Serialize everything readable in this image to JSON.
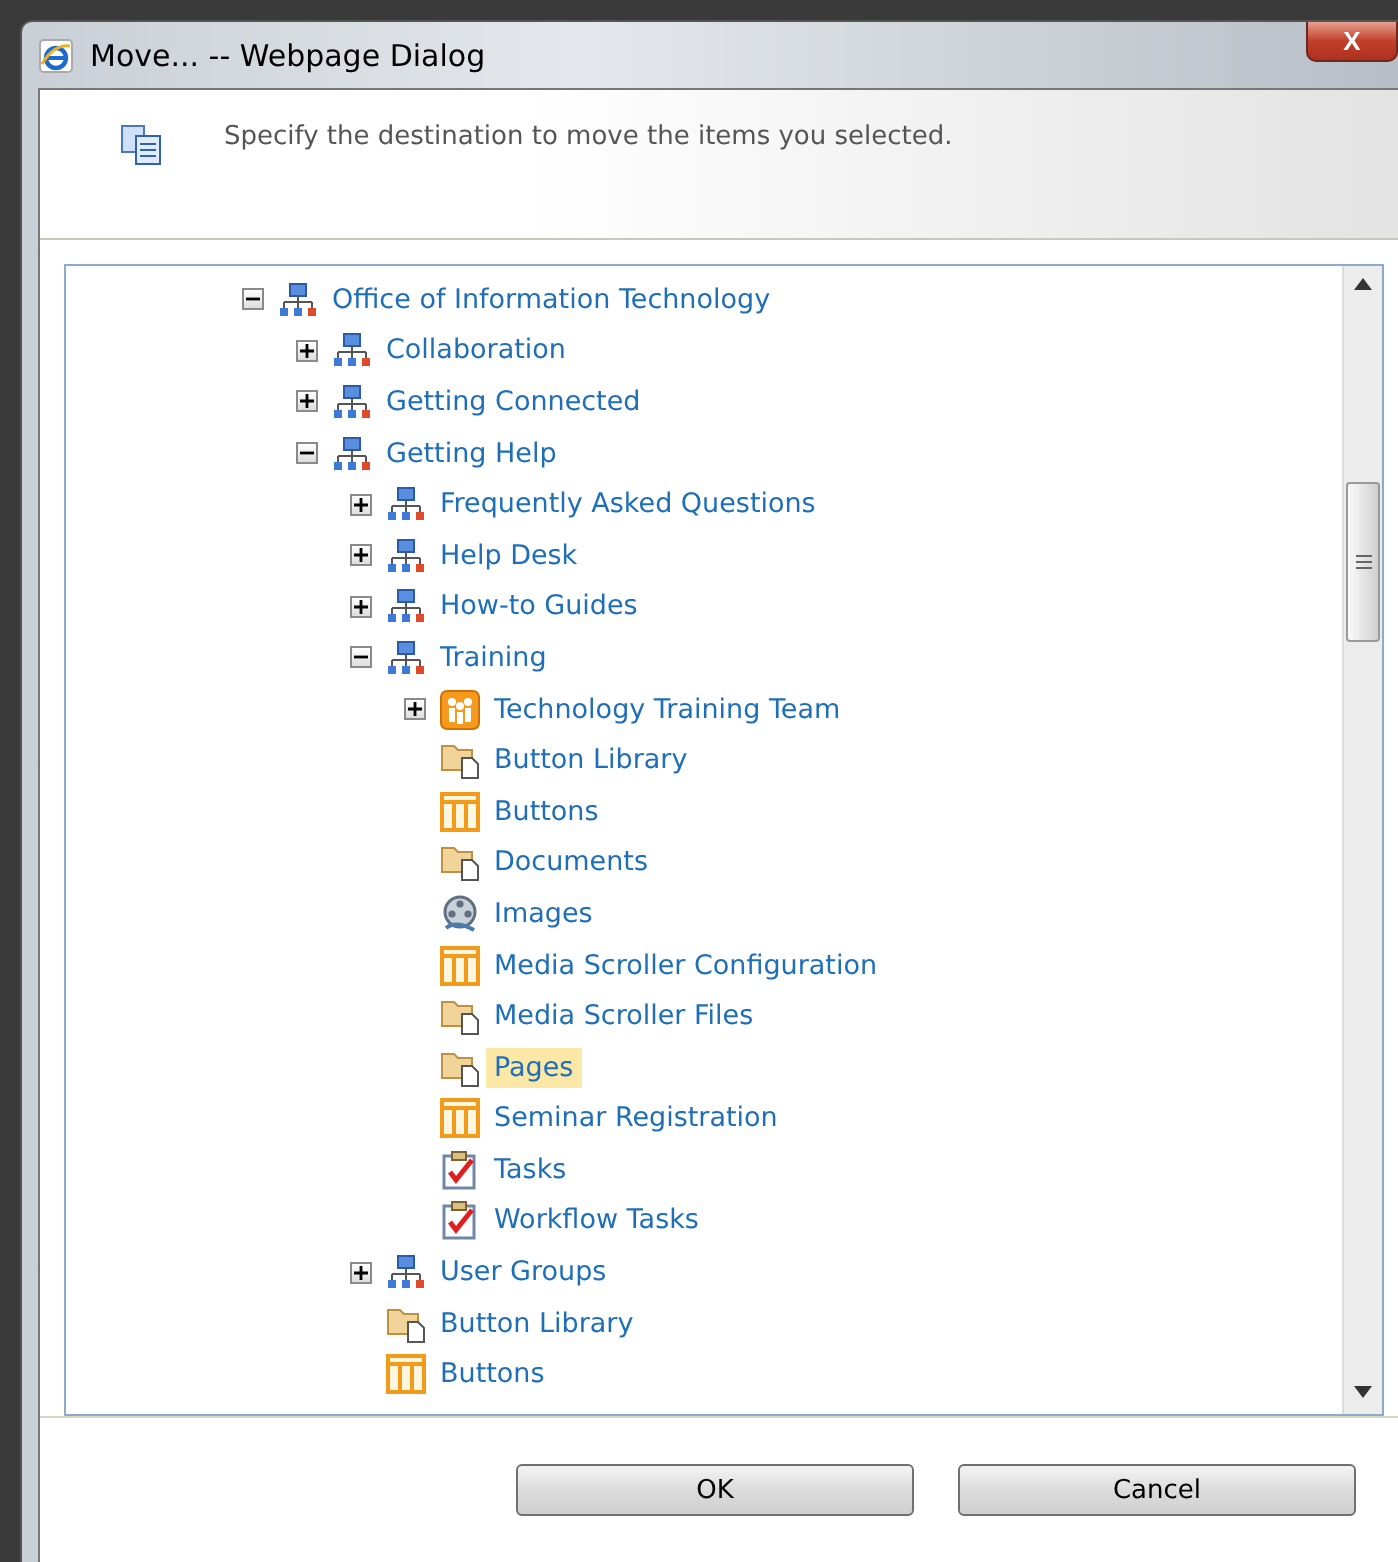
{
  "window": {
    "title": "Move... -- Webpage Dialog",
    "close": "X"
  },
  "instruction": "Specify the destination to move the items you selected.",
  "tree": [
    {
      "kind": "site",
      "label": "Office of Information Technology",
      "expanded": true,
      "selected": false,
      "children": [
        {
          "kind": "site",
          "label": "Collaboration",
          "expanded": false,
          "selected": false
        },
        {
          "kind": "site",
          "label": "Getting Connected",
          "expanded": false,
          "selected": false
        },
        {
          "kind": "site",
          "label": "Getting Help",
          "expanded": true,
          "selected": false,
          "children": [
            {
              "kind": "site",
              "label": "Frequently Asked Questions",
              "expanded": false,
              "selected": false
            },
            {
              "kind": "site",
              "label": "Help Desk",
              "expanded": false,
              "selected": false
            },
            {
              "kind": "site",
              "label": "How-to Guides",
              "expanded": false,
              "selected": false
            },
            {
              "kind": "site",
              "label": "Training",
              "expanded": true,
              "selected": false,
              "children": [
                {
                  "kind": "team",
                  "label": "Technology Training Team",
                  "expanded": false,
                  "selected": false
                },
                {
                  "kind": "library",
                  "label": "Button Library",
                  "selected": false
                },
                {
                  "kind": "list",
                  "label": "Buttons",
                  "selected": false
                },
                {
                  "kind": "library",
                  "label": "Documents",
                  "selected": false
                },
                {
                  "kind": "pictures",
                  "label": "Images",
                  "selected": false
                },
                {
                  "kind": "list",
                  "label": "Media Scroller Configuration",
                  "selected": false
                },
                {
                  "kind": "library",
                  "label": "Media Scroller Files",
                  "selected": false
                },
                {
                  "kind": "library",
                  "label": "Pages",
                  "selected": true
                },
                {
                  "kind": "list",
                  "label": "Seminar Registration",
                  "selected": false
                },
                {
                  "kind": "tasks",
                  "label": "Tasks",
                  "selected": false
                },
                {
                  "kind": "tasks",
                  "label": "Workflow Tasks",
                  "selected": false
                }
              ]
            },
            {
              "kind": "site",
              "label": "User Groups",
              "expanded": false,
              "selected": false
            },
            {
              "kind": "library",
              "label": "Button Library",
              "selected": false
            },
            {
              "kind": "list",
              "label": "Buttons",
              "selected": false
            }
          ]
        }
      ]
    }
  ],
  "buttons": [
    "OK",
    "Cancel"
  ]
}
